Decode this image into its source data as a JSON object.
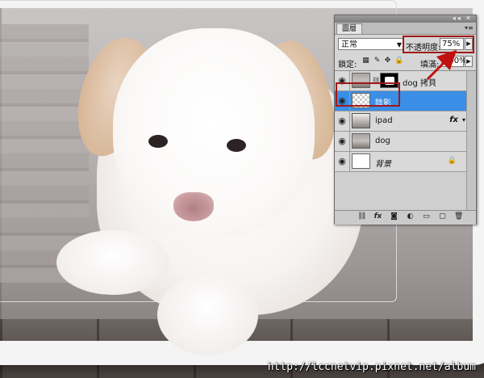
{
  "panel": {
    "tab_label": "圖層",
    "window_controls": "◂◂ ✕",
    "menu_icon": "panel-menu-icon",
    "blend_mode": "正常",
    "opacity_label": "不透明度:",
    "opacity_value": "75%",
    "lock_label": "鎖定:",
    "fill_label": "填滿:",
    "fill_value": "100%",
    "layers": [
      {
        "name": "dog 拷貝",
        "thumb": "photo",
        "has_mask": true,
        "selected": false
      },
      {
        "name": "陰影",
        "thumb": "transparent",
        "selected": true
      },
      {
        "name": "ipad",
        "thumb": "ipad",
        "fx": "fx",
        "selected": false
      },
      {
        "name": "dog",
        "thumb": "photo",
        "selected": false
      },
      {
        "name": "背景",
        "thumb": "white",
        "locked": true,
        "selected": false
      }
    ],
    "bottom_icons": [
      "link-icon",
      "fx-icon",
      "mask-icon",
      "adjustment-icon",
      "group-icon",
      "new-layer-icon",
      "trash-icon"
    ]
  },
  "annotation": {
    "highlight_color": "#a01818",
    "arrow_color": "#c01010"
  },
  "colors": {
    "selected_layer": "#3a8ee6"
  },
  "watermark": "http://lccnetvip.pixnet.net/album"
}
